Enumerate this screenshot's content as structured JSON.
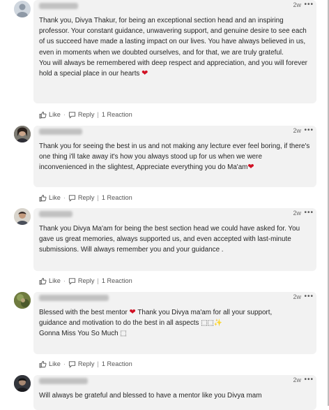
{
  "comments": [
    {
      "time": "2w",
      "paragraphs": [
        "Thank you, Divya Thakur, for being an exceptional section head and an inspiring professor. Your constant guidance, unwavering support, and genuine desire to see each of us succeed have made a lasting impact on our lives. You have always believed in us, even in moments when we doubted ourselves, and for that, we are truly grateful.",
        "You will always be remembered with deep respect and appreciation, and you will forever hold a special place in our hearts"
      ],
      "heart": "❤",
      "actions": {
        "like": "Like",
        "reply": "Reply",
        "reactions": "1 Reaction"
      }
    },
    {
      "time": "2w",
      "paragraphs": [
        "Thank you for seeing the best in us and not making any lecture ever feel boring, if there's one thing i'll take away it's how you always stood up for us when we were inconvenienced in the slightest, Appreciate everything you do Ma'am"
      ],
      "heart": "❤",
      "actions": {
        "like": "Like",
        "reply": "Reply",
        "reactions": "1 Reaction"
      }
    },
    {
      "time": "2w",
      "paragraphs": [
        "Thank you Divya Ma'am for being the best section head we could have asked for. You gave us great memories, always supported us, and even accepted with last-minute submissions. Will always remember you and your guidance ."
      ],
      "actions": {
        "like": "Like",
        "reply": "Reply",
        "reactions": "1 Reaction"
      }
    },
    {
      "time": "2w",
      "line1a": "Blessed with the best mentor",
      "heart": "❤",
      "line1b": " Thank you Divya ma'am for all your support,",
      "line2": "guidance and motivation to do the best in all aspects ⬚⬚✨",
      "line3": "Gonna Miss You So Much ⬚",
      "actions": {
        "like": "Like",
        "reply": "Reply",
        "reactions": "1 Reaction"
      }
    },
    {
      "time": "2w",
      "paragraphs": [
        "Will always be grateful and blessed to have a mentor like you Divya mam"
      ]
    }
  ],
  "icons": {
    "like": "thumbs-up-icon",
    "reply": "speech-bubble-icon",
    "more": "more-dots-icon"
  },
  "colors": {
    "heart": "#d11124",
    "bubble": "#f2f2f2"
  }
}
